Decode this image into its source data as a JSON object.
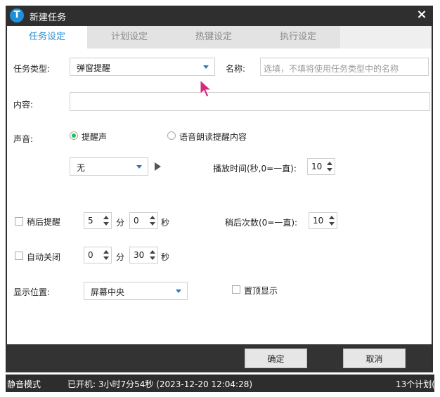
{
  "window": {
    "title": "新建任务",
    "logo_letter": "T",
    "close_glyph": "×"
  },
  "tabs": [
    {
      "label": "任务设定",
      "active": true
    },
    {
      "label": "计划设定",
      "active": false
    },
    {
      "label": "热键设定",
      "active": false
    },
    {
      "label": "执行设定",
      "active": false
    }
  ],
  "form": {
    "task_type_label": "任务类型:",
    "task_type_value": "弹窗提醒",
    "name_label": "名称:",
    "name_placeholder": "选填，不填将使用任务类型中的名称",
    "content_label": "内容:",
    "sound_label": "声音:",
    "sound_option1": "提醒声",
    "sound_option1_checked": true,
    "sound_option2": "语音朗读提醒内容",
    "sound_option2_checked": false,
    "sound_select_value": "无",
    "play_duration_label": "播放时间(秒,0=一直):",
    "play_duration_value": "10",
    "snooze_label": "稍后提醒",
    "snooze_minutes": "5",
    "snooze_seconds": "0",
    "minute_unit": "分",
    "second_unit": "秒",
    "snooze_count_label": "稍后次数(0=一直):",
    "snooze_count_value": "10",
    "auto_close_label": "自动关闭",
    "auto_close_minutes": "0",
    "auto_close_seconds": "30",
    "position_label": "显示位置:",
    "position_value": "屏幕中央",
    "topmost_label": "置顶显示"
  },
  "footer": {
    "ok_label": "确定",
    "cancel_label": "取消"
  },
  "statusbar": {
    "mode": "静音模式",
    "uptime": "已开机: 3小时7分54秒 (2023-12-20 12:04:28)",
    "plans": "13个计划("
  },
  "colors": {
    "accent": "#2a8fd4",
    "radio_selected": "#1fbf5a",
    "cursor": "#d6287c"
  }
}
